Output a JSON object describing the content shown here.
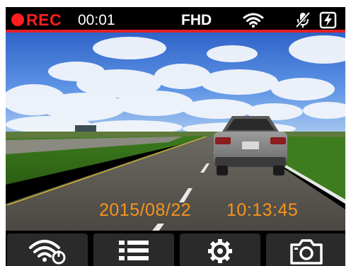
{
  "status_bar": {
    "rec_label": "REC",
    "rec_time": "00:01",
    "resolution": "FHD",
    "icons": [
      "wifi-icon",
      "mic-mute-icon",
      "charging-battery-icon"
    ],
    "rec_color": "#ff1e1e",
    "accent_line_color": "#e41e26"
  },
  "overlay": {
    "date": "2015/08/22",
    "time": "10:13:45",
    "color": "#f7941d"
  },
  "toolbar": {
    "buttons": [
      {
        "icon": "wifi-power-icon"
      },
      {
        "icon": "menu-list-icon"
      },
      {
        "icon": "settings-gear-icon"
      },
      {
        "icon": "camera-icon"
      }
    ]
  }
}
